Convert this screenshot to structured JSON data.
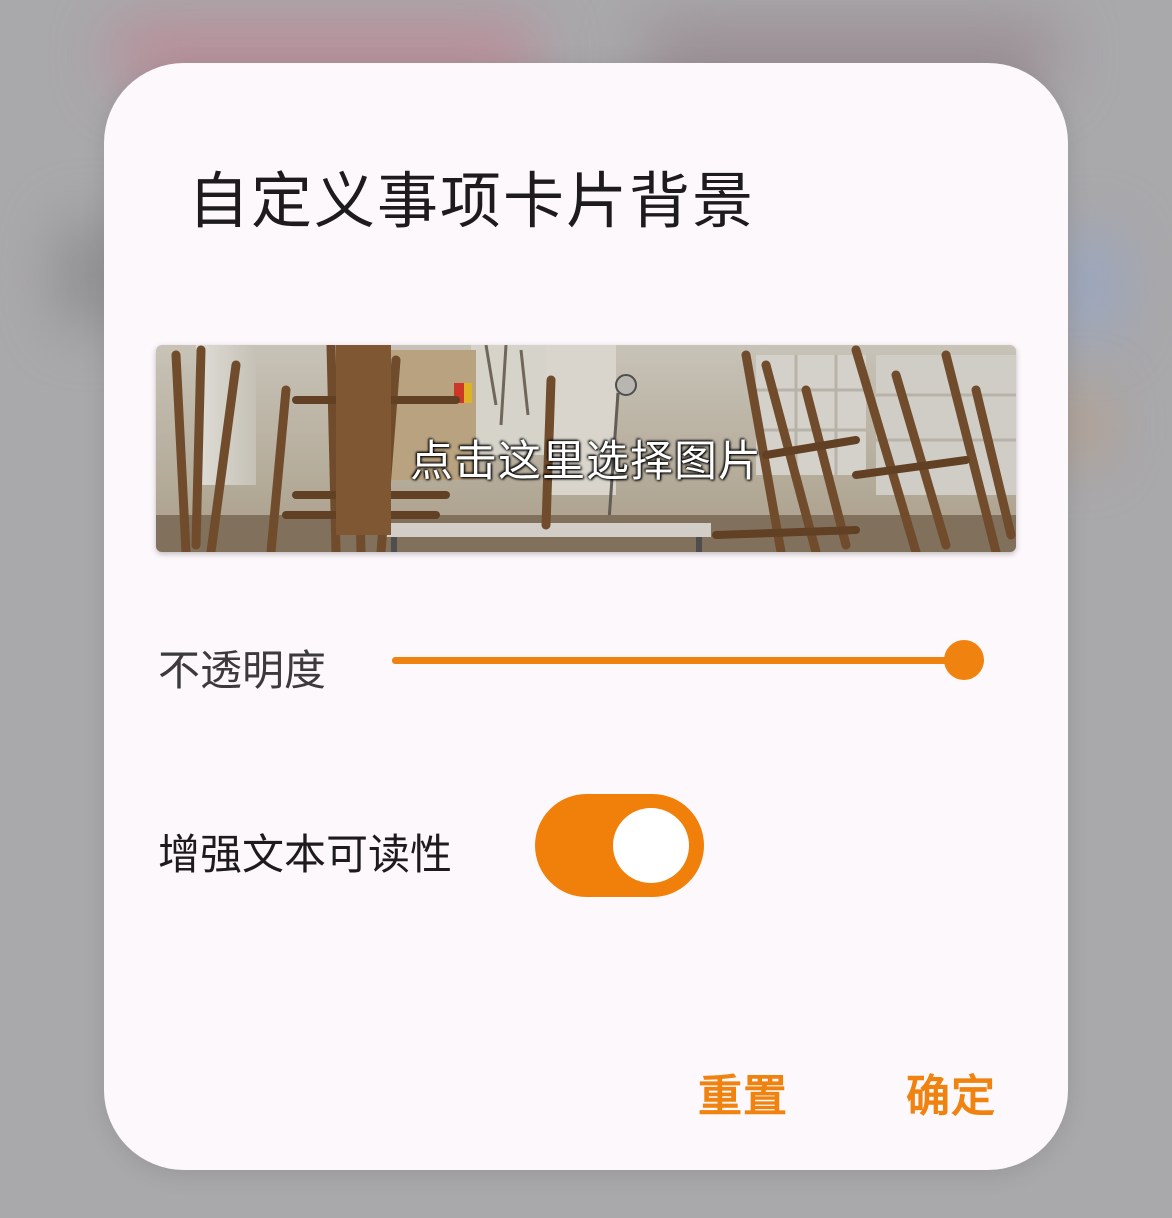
{
  "dialog": {
    "title": "自定义事项卡片背景",
    "image_picker": {
      "label": "点击这里选择图片",
      "image": "art-classroom-easels-photo"
    },
    "opacity": {
      "label": "不透明度",
      "value": 1.0
    },
    "readability": {
      "label": "增强文本可读性",
      "enabled": true
    },
    "buttons": {
      "reset": "重置",
      "confirm": "确定"
    }
  },
  "colors": {
    "accent": "#f0830f",
    "dialog_background": "#fdf8fb",
    "title_text": "#1e1b1e",
    "backdrop": "#a9a8ab"
  }
}
